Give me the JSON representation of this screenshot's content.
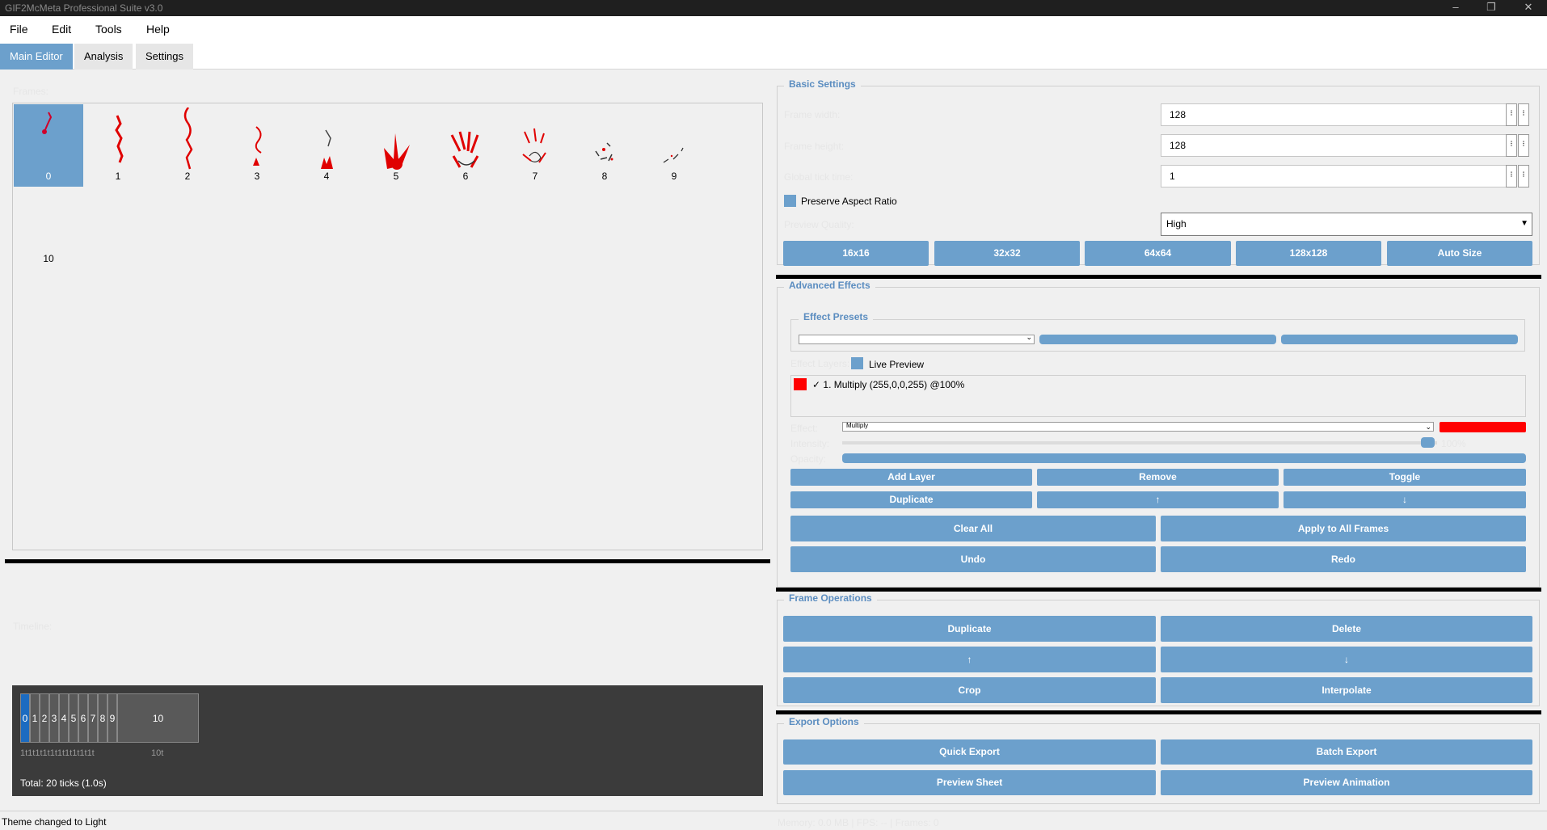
{
  "window": {
    "title": "GIF2McMeta Professional Suite v3.0",
    "controls": [
      "–",
      "❐",
      "✕"
    ]
  },
  "menu": [
    "File",
    "Edit",
    "Tools",
    "Help"
  ],
  "tabs": [
    "Main Editor",
    "Analysis",
    "Settings"
  ],
  "frames": {
    "label": "Frames:",
    "items": [
      "0",
      "1",
      "2",
      "3",
      "4",
      "5",
      "6",
      "7",
      "8",
      "9",
      "10"
    ],
    "selected": 0
  },
  "timeline": {
    "label": "Timeline:",
    "cells": [
      "0",
      "1",
      "2",
      "3",
      "4",
      "5",
      "6",
      "7",
      "8",
      "9",
      "10"
    ],
    "ticks": "1t1t1t1t1t1t1t1t1t1t",
    "last_tick": "10t",
    "total": "Total: 20 ticks (1.0s)"
  },
  "basic_settings": {
    "title": "Basic Settings",
    "frame_width_label": "Frame width:",
    "frame_width": "128",
    "frame_height_label": "Frame height:",
    "frame_height": "128",
    "global_ticks_label": "Global tick time:",
    "global_ticks": "1",
    "preserve_label": "Preserve Aspect Ratio",
    "quality_label": "Preview Quality:",
    "quality": "High",
    "size_buttons": [
      "16x16",
      "32x32",
      "64x64",
      "128x128",
      "Auto Size"
    ]
  },
  "advanced_effects": {
    "title": "Advanced Effects",
    "presets_title": "Effect Presets",
    "layers_label": "Effect Layers:",
    "live_preview": "Live Preview",
    "layer_item": "✓ 1. Multiply (255,0,0,255) @100%",
    "layer_color": "#ff0000",
    "effect_label": "Effect:",
    "effect_value": "Multiply",
    "intensity_label": "Intensity:",
    "intensity_value": "100%",
    "intensity": 1.0,
    "opacity_label": "Opacity:",
    "layer_buttons": [
      "Add Layer",
      "Remove",
      "Toggle",
      "Duplicate",
      "↑",
      "↓"
    ],
    "action_buttons": [
      "Clear All",
      "Apply to All Frames",
      "Undo",
      "Redo"
    ]
  },
  "frame_operations": {
    "title": "Frame Operations",
    "buttons": [
      "Duplicate",
      "Delete",
      "↑",
      "↓",
      "Crop",
      "Interpolate"
    ]
  },
  "export_options": {
    "title": "Export Options",
    "buttons": [
      "Quick Export",
      "Batch Export",
      "Preview Sheet",
      "Preview Animation"
    ]
  },
  "status": {
    "message": "Theme changed to Light",
    "stats": "Memory: 0.0 MB | FPS: -- | Frames: 0"
  },
  "colors": {
    "accent": "#6ca0cc",
    "effect_red": "#ff0000"
  }
}
